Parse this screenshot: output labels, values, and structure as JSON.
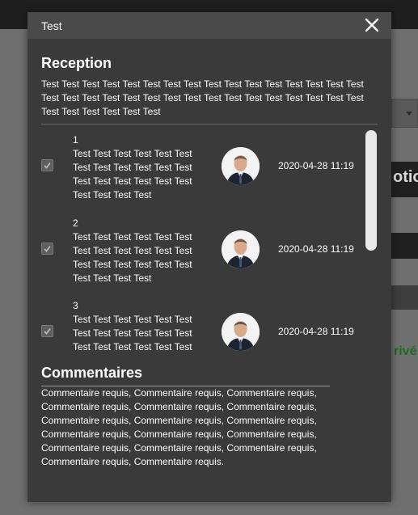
{
  "modal": {
    "title": "Test",
    "close_icon": "close-icon"
  },
  "reception": {
    "title": "Reception",
    "text": "Test Test Test Test Test Test Test Test Test Test Test Test Test Test Test Test Test Test Test Test Test Test Test Test Test Test Test Test Test Test Test Test Test Test Test Test Test Test"
  },
  "items": [
    {
      "number": "1",
      "text": "Test Test Test Test Test Test Test Test Test Test Test Test Test Test Test Test Test Test Test Test Test Test",
      "date": "2020-04-28 11:19",
      "checked": true,
      "avatar_icon": "person-avatar"
    },
    {
      "number": "2",
      "text": "Test Test Test Test Test Test Test Test Test Test Test Test Test Test Test Test Test Test Test Test Test Test",
      "date": "2020-04-28 11:19",
      "checked": true,
      "avatar_icon": "person-avatar"
    },
    {
      "number": "3",
      "text": "Test Test Test Test Test Test Test Test Test Test Test Test Test Test Test Test Test Test",
      "date": "2020-04-28 11:19",
      "checked": true,
      "avatar_icon": "person-avatar"
    }
  ],
  "comments": {
    "title": "Commentaires",
    "text": "Commentaire requis, Commentaire requis, Commentaire requis, Commentaire requis, Commentaire requis, Commentaire requis, Commentaire requis, Commentaire requis, Commentaire requis, Commentaire requis, Commentaire requis, Commentaire requis, Commentaire requis, Commentaire requis, Commentaire requis, Commentaire requis, Commentaire requis."
  },
  "background": {
    "heading_fragment": "otio",
    "status_fragment": "rivé"
  },
  "colors": {
    "modal_bg": "#3a3a3a",
    "header_bg": "#4a4a4a",
    "status_green": "#1f6b1f"
  }
}
